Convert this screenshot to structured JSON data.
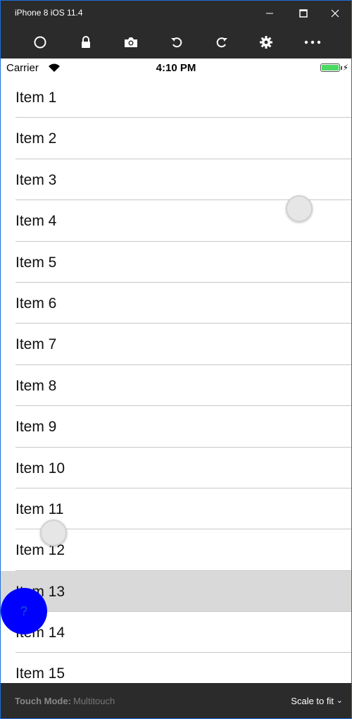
{
  "window": {
    "title": "iPhone 8 iOS 11.4",
    "minimize_glyph": "—",
    "maximize_glyph": "☐",
    "close_glyph": "✕"
  },
  "toolbar": {
    "buttons": [
      {
        "name": "home-icon"
      },
      {
        "name": "lock-icon"
      },
      {
        "name": "camera-icon"
      },
      {
        "name": "rotate-left-icon"
      },
      {
        "name": "rotate-right-icon"
      },
      {
        "name": "gear-icon"
      },
      {
        "name": "more-icon"
      }
    ]
  },
  "statusbar": {
    "carrier": "Carrier",
    "time": "4:10 PM",
    "battery_level": 1.0,
    "battery_color": "#4cd964"
  },
  "list": {
    "items": [
      {
        "label": "Item 1"
      },
      {
        "label": "Item 2"
      },
      {
        "label": "Item 3"
      },
      {
        "label": "Item 4"
      },
      {
        "label": "Item 5"
      },
      {
        "label": "Item 6"
      },
      {
        "label": "Item 7"
      },
      {
        "label": "Item 8"
      },
      {
        "label": "Item 9"
      },
      {
        "label": "Item 10"
      },
      {
        "label": "Item 11"
      },
      {
        "label": "Item 12"
      },
      {
        "label": "Item 13"
      },
      {
        "label": "Item 14"
      },
      {
        "label": "Item 15"
      }
    ],
    "selected_item": "Item 13"
  },
  "help_button": {
    "label": "?",
    "color": "#0000ff"
  },
  "bottombar": {
    "touch_mode_label": "Touch Mode:",
    "touch_mode_value": "Multitouch",
    "scale_label": "Scale to fit",
    "scale_chevron": "⌄"
  }
}
